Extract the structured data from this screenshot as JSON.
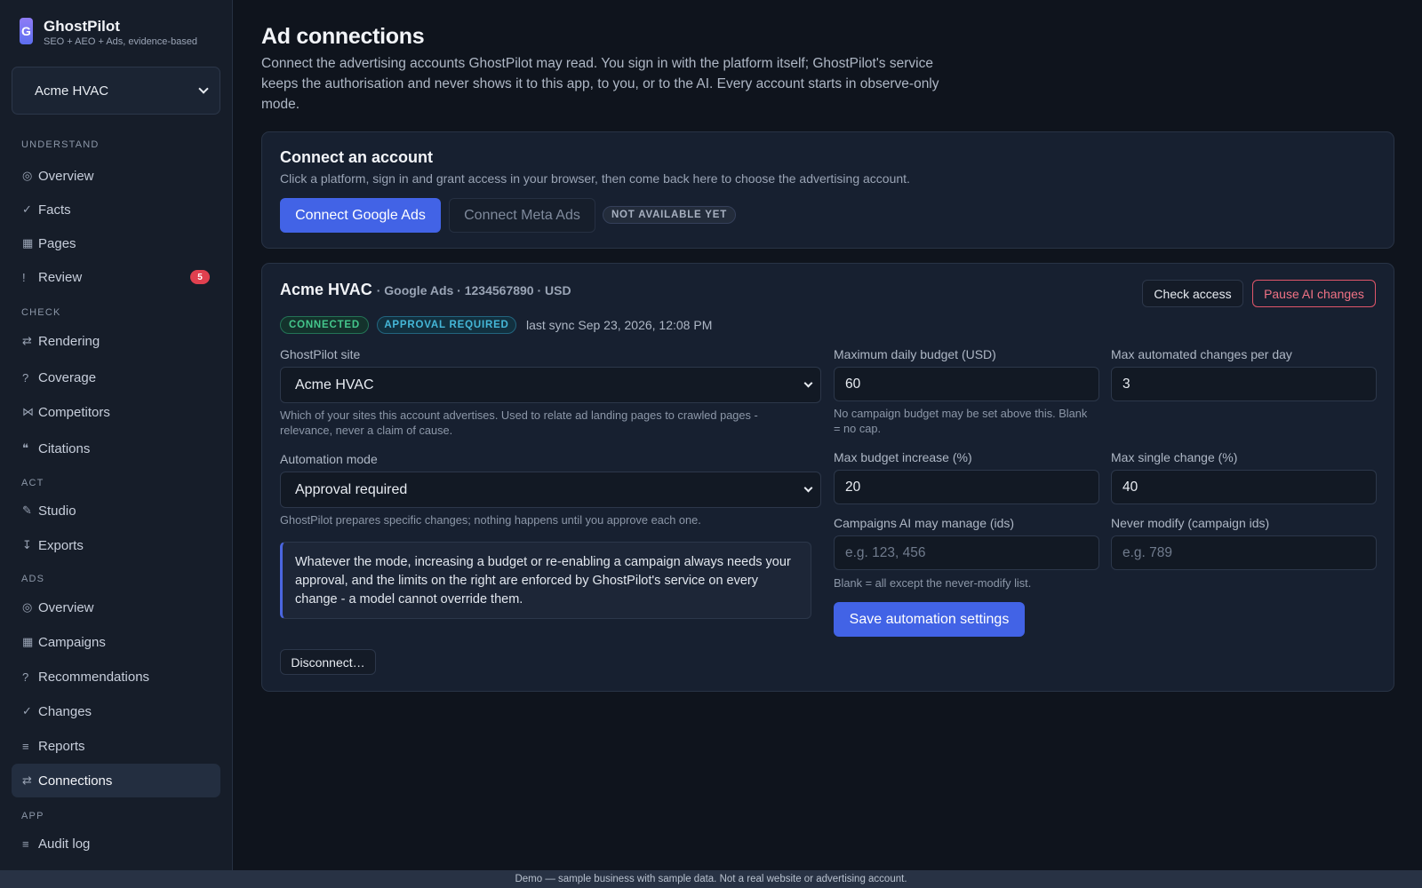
{
  "brand": {
    "logo_letter": "G",
    "name": "GhostPilot",
    "tagline": "SEO + AEO + Ads, evidence-based"
  },
  "site_picker": {
    "value": "Acme HVAC"
  },
  "nav": {
    "sections": [
      {
        "label": "UNDERSTAND"
      },
      {
        "label": "CHECK"
      },
      {
        "label": "ACT"
      },
      {
        "label": "ADS"
      },
      {
        "label": "APP"
      }
    ],
    "items": [
      {
        "icon": "◎",
        "label": "Overview"
      },
      {
        "icon": "✓",
        "label": "Facts"
      },
      {
        "icon": "▦",
        "label": "Pages"
      },
      {
        "icon": "!",
        "label": "Review",
        "badge": "5"
      },
      {
        "icon": "⇄",
        "label": "Rendering"
      },
      {
        "icon": "?",
        "label": "Coverage"
      },
      {
        "icon": "⋈",
        "label": "Competitors"
      },
      {
        "icon": "❝",
        "label": "Citations"
      },
      {
        "icon": "✎",
        "label": "Studio"
      },
      {
        "icon": "↧",
        "label": "Exports"
      },
      {
        "icon": "◎",
        "label": "Overview"
      },
      {
        "icon": "▦",
        "label": "Campaigns"
      },
      {
        "icon": "?",
        "label": "Recommendations"
      },
      {
        "icon": "✓",
        "label": "Changes"
      },
      {
        "icon": "≡",
        "label": "Reports"
      },
      {
        "icon": "⇄",
        "label": "Connections"
      },
      {
        "icon": "≡",
        "label": "Audit log"
      }
    ]
  },
  "page": {
    "title": "Ad connections",
    "description": "Connect the advertising accounts GhostPilot may read. You sign in with the platform itself; GhostPilot's service keeps the authorisation and never shows it to this app, to you, or to the AI. Every account starts in observe-only mode."
  },
  "connect_card": {
    "title": "Connect an account",
    "subtitle": "Click a platform, sign in and grant access in your browser, then come back here to choose the advertising account.",
    "google_button": "Connect Google Ads",
    "meta_button": "Connect Meta Ads",
    "meta_badge": "NOT AVAILABLE YET"
  },
  "account": {
    "name": "Acme HVAC",
    "meta": "· Google Ads · 1234567890 · USD",
    "check_access": "Check access",
    "pause_ai": "Pause AI changes",
    "status_connected": "CONNECTED",
    "status_approval": "APPROVAL REQUIRED",
    "last_sync": "last sync Sep 23, 2026, 12:08 PM",
    "site_label": "GhostPilot site",
    "site_value": "Acme HVAC",
    "site_hint": "Which of your sites this account advertises. Used to relate ad landing pages to crawled pages - relevance, never a claim of cause.",
    "mode_label": "Automation mode",
    "mode_value": "Approval required",
    "mode_hint": "GhostPilot prepares specific changes; nothing happens until you approve each one.",
    "note": "Whatever the mode, increasing a budget or re-enabling a campaign always needs your approval, and the limits on the right are enforced by GhostPilot's service on every change - a model cannot override them.",
    "disconnect": "Disconnect…",
    "max_budget_label": "Maximum daily budget (USD)",
    "max_budget_value": "60",
    "max_budget_hint": "No campaign budget may be set above this. Blank = no cap.",
    "max_changes_label": "Max automated changes per day",
    "max_changes_value": "3",
    "max_increase_label": "Max budget increase (%)",
    "max_increase_value": "20",
    "max_single_label": "Max single change (%)",
    "max_single_value": "40",
    "campaigns_label": "Campaigns AI may manage (ids)",
    "campaigns_placeholder": "e.g. 123, 456",
    "never_label": "Never modify (campaign ids)",
    "never_placeholder": "e.g. 789",
    "campaigns_hint": "Blank = all except the never-modify list.",
    "save_button": "Save automation settings"
  },
  "footer": {
    "text": "Demo — sample business with sample data. Not a real website or advertising account."
  }
}
